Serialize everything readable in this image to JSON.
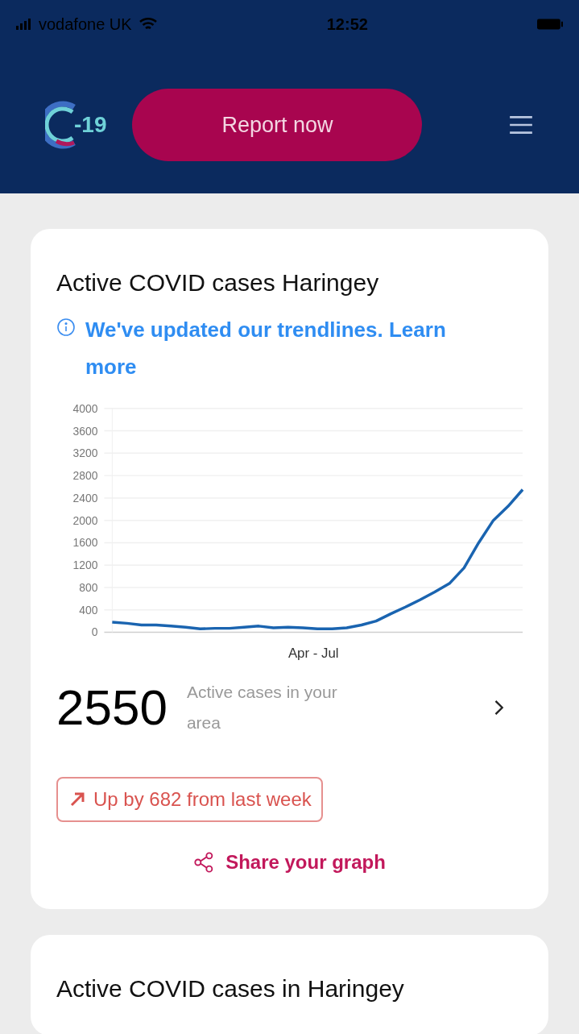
{
  "status_bar": {
    "carrier": "vodafone UK",
    "time": "12:52"
  },
  "header": {
    "logo_text": "-19",
    "report_button": "Report now"
  },
  "cards": [
    {
      "title": "Active COVID cases Haringey",
      "notice": "We've updated our trendlines. Learn more",
      "chart_data": {
        "type": "line",
        "grid": true,
        "xlabel": "Apr - Jul",
        "ylim": [
          0,
          4000
        ],
        "yticks": [
          0,
          400,
          800,
          1200,
          1600,
          2000,
          2400,
          2800,
          3200,
          3600,
          4000
        ],
        "series": [
          {
            "color": "#1a64b0",
            "values": [
              180,
              160,
              130,
              130,
              110,
              90,
              60,
              70,
              70,
              90,
              110,
              80,
              90,
              80,
              60,
              60,
              80,
              130,
              200,
              330,
              450,
              580,
              720,
              870,
              1150,
              1600,
              2000,
              2250,
              2550
            ]
          }
        ]
      },
      "count": "2550",
      "count_label": "Active cases in your area",
      "trend": "Up by 682 from last week",
      "share": "Share your graph"
    },
    {
      "title": "Active COVID cases in Haringey"
    }
  ]
}
